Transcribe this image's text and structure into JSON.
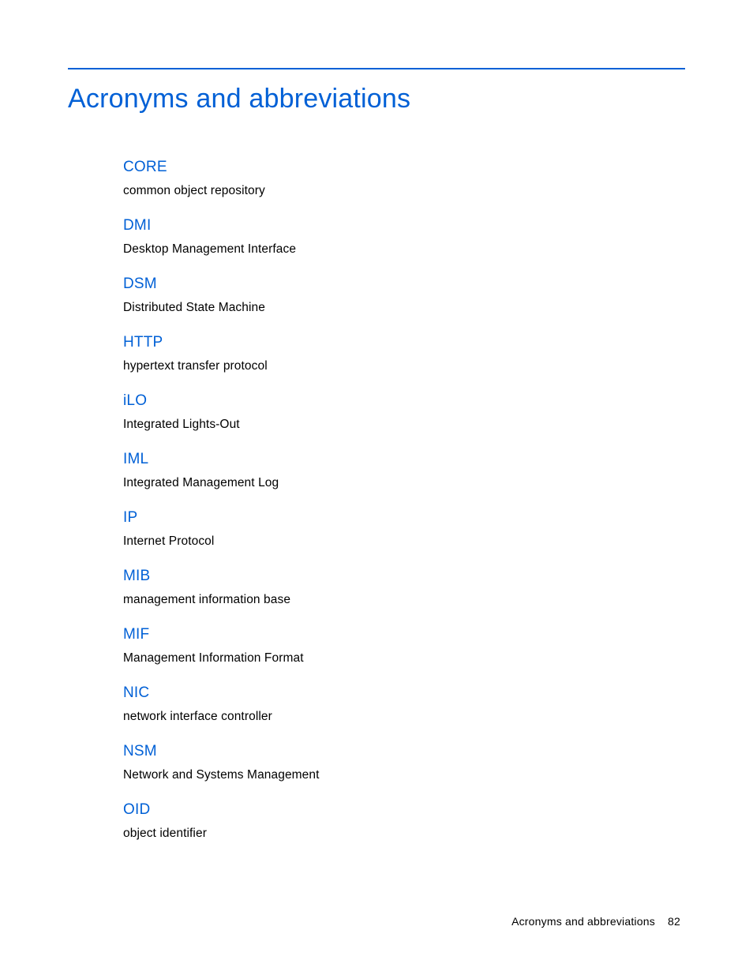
{
  "title": "Acronyms and abbreviations",
  "entries": [
    {
      "term": "CORE",
      "definition": "common object repository"
    },
    {
      "term": "DMI",
      "definition": "Desktop Management Interface"
    },
    {
      "term": "DSM",
      "definition": "Distributed State Machine"
    },
    {
      "term": "HTTP",
      "definition": "hypertext transfer protocol"
    },
    {
      "term": "iLO",
      "definition": "Integrated Lights-Out"
    },
    {
      "term": "IML",
      "definition": "Integrated Management Log"
    },
    {
      "term": "IP",
      "definition": "Internet Protocol"
    },
    {
      "term": "MIB",
      "definition": "management information base"
    },
    {
      "term": "MIF",
      "definition": "Management Information Format"
    },
    {
      "term": "NIC",
      "definition": "network interface controller"
    },
    {
      "term": "NSM",
      "definition": "Network and Systems Management"
    },
    {
      "term": "OID",
      "definition": "object identifier"
    }
  ],
  "footer": {
    "section": "Acronyms and abbreviations",
    "page": "82"
  }
}
